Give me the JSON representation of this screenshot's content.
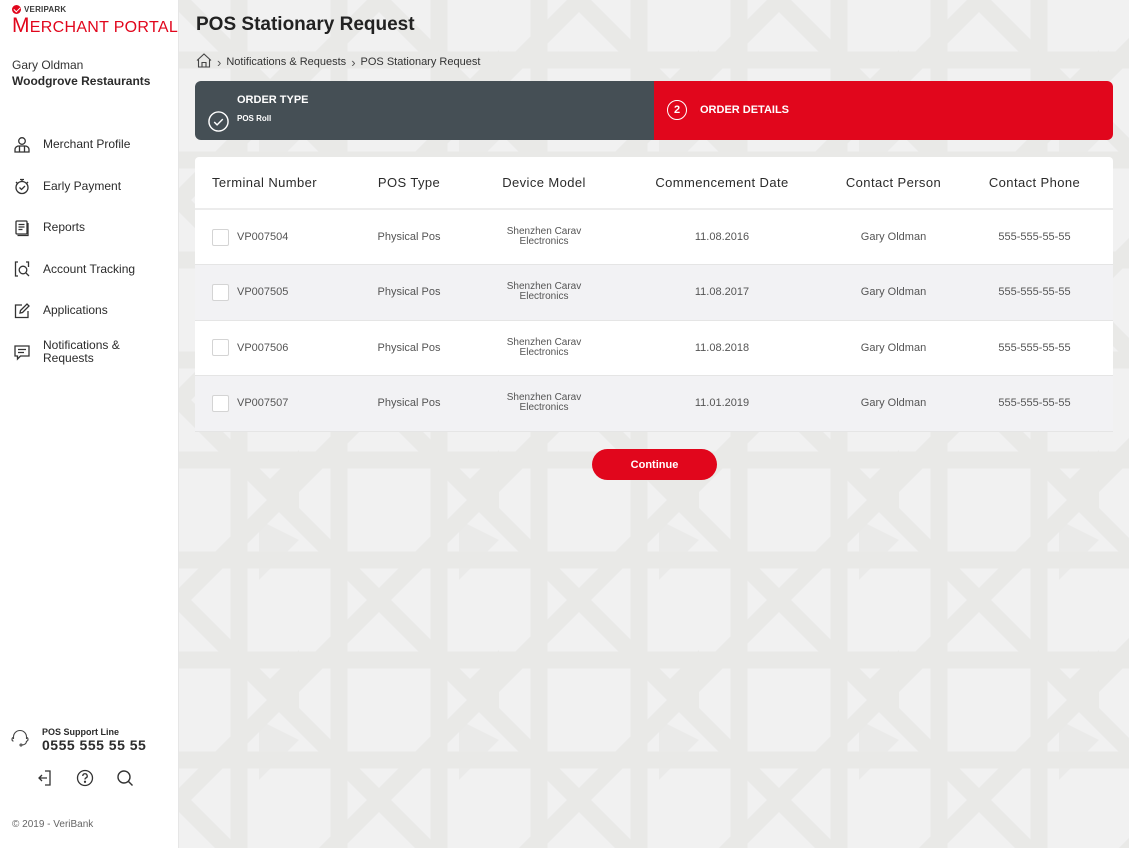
{
  "brand": {
    "company_small": "VERIPARK",
    "portal_name_first": "M",
    "portal_name_rest": "ERCHANT PORTAL",
    "accent_color": "#e1061c",
    "dark_color": "#454f55"
  },
  "user": {
    "name": "Gary Oldman",
    "company": "Woodgrove Restaurants"
  },
  "sidebar": {
    "items": [
      {
        "label": "Merchant Profile",
        "icon": "merchant-profile-icon"
      },
      {
        "label": "Early Payment",
        "icon": "stopwatch-icon"
      },
      {
        "label": "Reports",
        "icon": "document-icon"
      },
      {
        "label": "Account Tracking",
        "icon": "search-document-icon"
      },
      {
        "label": "Applications",
        "icon": "edit-icon"
      },
      {
        "label": "Notifications & Requests",
        "icon": "message-icon"
      }
    ],
    "support_label": "POS Support Line",
    "support_phone": "0555 555 55 55",
    "bottom_icons": [
      "logout-icon",
      "help-icon",
      "search-icon"
    ],
    "copyright": "© 2019 - VeriBank"
  },
  "header": {
    "title": "POS Stationary Request",
    "breadcrumb": [
      "Notifications & Requests",
      "POS Stationary Request"
    ]
  },
  "steps": [
    {
      "title": "ORDER TYPE",
      "subtitle": "POS Roll",
      "status": "completed"
    },
    {
      "number": "2",
      "title": "ORDER DETAILS",
      "status": "active"
    }
  ],
  "table": {
    "columns": [
      "Terminal Number",
      "POS Type",
      "Device Model",
      "Commencement Date",
      "Contact Person",
      "Contact Phone"
    ],
    "rows": [
      {
        "terminal": "VP007504",
        "pos_type": "Physical Pos",
        "model_line1": "Shenzhen Carav",
        "model_line2": "Electronics",
        "date": "11.08.2016",
        "contact": "Gary Oldman",
        "phone": "555-555-55-55",
        "checked": false
      },
      {
        "terminal": "VP007505",
        "pos_type": "Physical Pos",
        "model_line1": "Shenzhen Carav",
        "model_line2": "Electronics",
        "date": "11.08.2017",
        "contact": "Gary Oldman",
        "phone": "555-555-55-55",
        "checked": false
      },
      {
        "terminal": "VP007506",
        "pos_type": "Physical Pos",
        "model_line1": "Shenzhen Carav",
        "model_line2": "Electronics",
        "date": "11.08.2018",
        "contact": "Gary Oldman",
        "phone": "555-555-55-55",
        "checked": false
      },
      {
        "terminal": "VP007507",
        "pos_type": "Physical Pos",
        "model_line1": "Shenzhen Carav",
        "model_line2": "Electronics",
        "date": "11.01.2019",
        "contact": "Gary Oldman",
        "phone": "555-555-55-55",
        "checked": false
      }
    ]
  },
  "actions": {
    "continue_label": "Continue"
  }
}
